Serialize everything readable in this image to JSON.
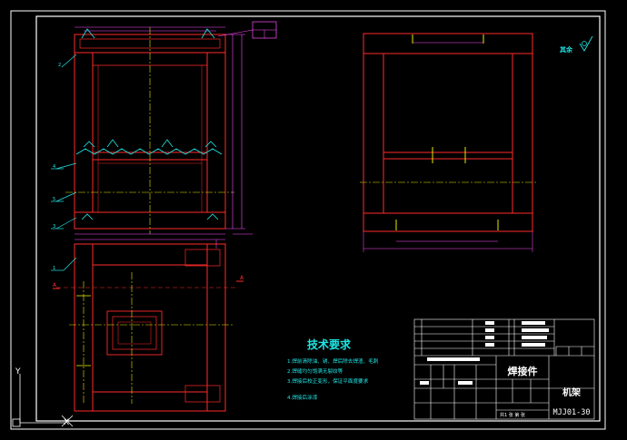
{
  "colors": {
    "background": "#000000",
    "frame": "#ffffff",
    "steel": "#ff2a2a",
    "dimension": "#ff4dff",
    "annotation": "#20e6e6",
    "centerline": "#e8e800"
  },
  "tech": {
    "title": "技术要求",
    "lines": [
      "1.焊前清除油、锈、焊后除去焊渣、毛刺",
      "2.焊缝均匀饱满无裂纹等",
      "3.焊接后校正变形，保证平面度要求",
      "4.焊接后涂漆"
    ]
  },
  "surface_note": "其余",
  "title_block": {
    "assembly_type": "焊接件",
    "part_name": "机架",
    "drawing_no": "MJJ01-30",
    "scale_row": "共1 张 第 张"
  },
  "ucs": {
    "y_axis": "Y",
    "x_axis": "X"
  },
  "leaders": [
    "1",
    "2",
    "3",
    "4",
    "5"
  ],
  "section_marks": [
    "A",
    "A"
  ]
}
